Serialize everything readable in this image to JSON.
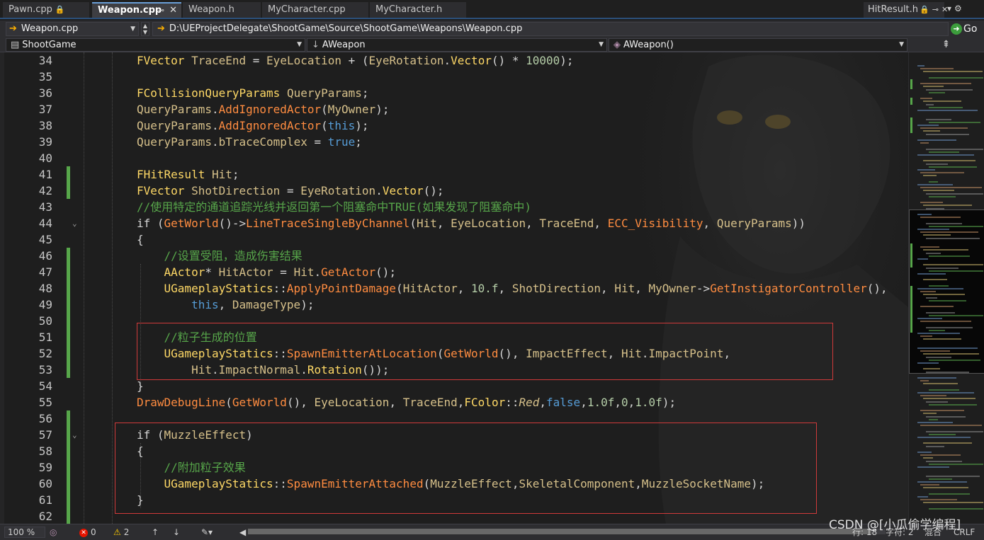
{
  "tabs": [
    {
      "label": "Pawn.cpp",
      "lock": "🔒",
      "active": false
    },
    {
      "label": "Weapon.cpp",
      "active": true
    },
    {
      "label": "Weapon.h",
      "active": false
    },
    {
      "label": "MyCharacter.cpp",
      "active": false
    },
    {
      "label": "MyCharacter.h",
      "active": false
    }
  ],
  "right_tab": {
    "label": "HitResult.h",
    "lock": "🔒"
  },
  "file_selector": {
    "value": "Weapon.cpp"
  },
  "path": {
    "value": "D:\\UEProjectDelegate\\ShootGame\\Source\\ShootGame\\Weapons\\Weapon.cpp"
  },
  "go_button": {
    "label": "Go"
  },
  "nav": {
    "project": "ShootGame",
    "scope": "AWeapon",
    "member": "AWeapon()"
  },
  "code_lines": [
    {
      "n": "34",
      "chg": false,
      "fold": "",
      "tokens": [
        [
          "t-type",
          "FVector"
        ],
        [
          "t-plain",
          " "
        ],
        [
          "t-var",
          "TraceEnd"
        ],
        [
          "t-plain",
          " = "
        ],
        [
          "t-var",
          "EyeLocation"
        ],
        [
          "t-plain",
          " + ("
        ],
        [
          "t-var",
          "EyeRotation"
        ],
        [
          "t-plain",
          "."
        ],
        [
          "t-type",
          "Vector"
        ],
        [
          "t-plain",
          "() * "
        ],
        [
          "t-num",
          "10000"
        ],
        [
          "t-plain",
          ");"
        ]
      ]
    },
    {
      "n": "35",
      "chg": false,
      "fold": "",
      "tokens": []
    },
    {
      "n": "36",
      "chg": false,
      "fold": "",
      "tokens": [
        [
          "t-type",
          "FCollisionQueryParams"
        ],
        [
          "t-plain",
          " "
        ],
        [
          "t-var",
          "QueryParams"
        ],
        [
          "t-plain",
          ";"
        ]
      ]
    },
    {
      "n": "37",
      "chg": false,
      "fold": "",
      "tokens": [
        [
          "t-var",
          "QueryParams"
        ],
        [
          "t-plain",
          "."
        ],
        [
          "t-func",
          "AddIgnoredActor"
        ],
        [
          "t-plain",
          "("
        ],
        [
          "t-var",
          "MyOwner"
        ],
        [
          "t-plain",
          ");"
        ]
      ]
    },
    {
      "n": "38",
      "chg": false,
      "fold": "",
      "tokens": [
        [
          "t-var",
          "QueryParams"
        ],
        [
          "t-plain",
          "."
        ],
        [
          "t-func",
          "AddIgnoredActor"
        ],
        [
          "t-plain",
          "("
        ],
        [
          "t-kw",
          "this"
        ],
        [
          "t-plain",
          ");"
        ]
      ]
    },
    {
      "n": "39",
      "chg": false,
      "fold": "",
      "tokens": [
        [
          "t-var",
          "QueryParams"
        ],
        [
          "t-plain",
          "."
        ],
        [
          "t-var",
          "bTraceComplex"
        ],
        [
          "t-plain",
          " = "
        ],
        [
          "t-kw",
          "true"
        ],
        [
          "t-plain",
          ";"
        ]
      ]
    },
    {
      "n": "40",
      "chg": false,
      "fold": "",
      "tokens": []
    },
    {
      "n": "41",
      "chg": true,
      "fold": "",
      "tokens": [
        [
          "t-type",
          "FHitResult"
        ],
        [
          "t-plain",
          " "
        ],
        [
          "t-var",
          "Hit"
        ],
        [
          "t-plain",
          ";"
        ]
      ]
    },
    {
      "n": "42",
      "chg": true,
      "fold": "",
      "tokens": [
        [
          "t-type",
          "FVector"
        ],
        [
          "t-plain",
          " "
        ],
        [
          "t-var",
          "ShotDirection"
        ],
        [
          "t-plain",
          " = "
        ],
        [
          "t-var",
          "EyeRotation"
        ],
        [
          "t-plain",
          "."
        ],
        [
          "t-type",
          "Vector"
        ],
        [
          "t-plain",
          "();"
        ]
      ]
    },
    {
      "n": "43",
      "chg": false,
      "fold": "",
      "tokens": [
        [
          "t-cmt",
          "//使用特定的通道追踪光线并返回第一个阻塞命中TRUE(如果发现了阻塞命中)"
        ]
      ]
    },
    {
      "n": "44",
      "chg": false,
      "fold": "⌄",
      "tokens": [
        [
          "t-ctl",
          "if"
        ],
        [
          "t-plain",
          " ("
        ],
        [
          "t-func",
          "GetWorld"
        ],
        [
          "t-plain",
          "()->"
        ],
        [
          "t-func",
          "LineTraceSingleByChannel"
        ],
        [
          "t-plain",
          "("
        ],
        [
          "t-var",
          "Hit"
        ],
        [
          "t-plain",
          ", "
        ],
        [
          "t-var",
          "EyeLocation"
        ],
        [
          "t-plain",
          ", "
        ],
        [
          "t-var",
          "TraceEnd"
        ],
        [
          "t-plain",
          ", "
        ],
        [
          "t-func",
          "ECC_Visibility"
        ],
        [
          "t-plain",
          ", "
        ],
        [
          "t-var",
          "QueryParams"
        ],
        [
          "t-plain",
          "))"
        ]
      ]
    },
    {
      "n": "45",
      "chg": false,
      "fold": "",
      "tokens": [
        [
          "t-plain",
          "{"
        ]
      ]
    },
    {
      "n": "46",
      "chg": true,
      "fold": "",
      "tokens": [
        [
          "t-plain",
          "    "
        ],
        [
          "t-cmt",
          "//设置受阻，造成伤害结果"
        ]
      ]
    },
    {
      "n": "47",
      "chg": true,
      "fold": "",
      "tokens": [
        [
          "t-plain",
          "    "
        ],
        [
          "t-type",
          "AActor"
        ],
        [
          "t-plain",
          "* "
        ],
        [
          "t-var",
          "HitActor"
        ],
        [
          "t-plain",
          " = "
        ],
        [
          "t-var",
          "Hit"
        ],
        [
          "t-plain",
          "."
        ],
        [
          "t-func",
          "GetActor"
        ],
        [
          "t-plain",
          "();"
        ]
      ]
    },
    {
      "n": "48",
      "chg": true,
      "fold": "",
      "tokens": [
        [
          "t-plain",
          "    "
        ],
        [
          "t-type",
          "UGameplayStatics"
        ],
        [
          "t-plain",
          "::"
        ],
        [
          "t-func",
          "ApplyPointDamage"
        ],
        [
          "t-plain",
          "("
        ],
        [
          "t-var",
          "HitActor"
        ],
        [
          "t-plain",
          ", "
        ],
        [
          "t-num",
          "10.f"
        ],
        [
          "t-plain",
          ", "
        ],
        [
          "t-var",
          "ShotDirection"
        ],
        [
          "t-plain",
          ", "
        ],
        [
          "t-var",
          "Hit"
        ],
        [
          "t-plain",
          ", "
        ],
        [
          "t-var",
          "MyOwner"
        ],
        [
          "t-plain",
          "->"
        ],
        [
          "t-func",
          "GetInstigatorController"
        ],
        [
          "t-plain",
          "(),"
        ]
      ]
    },
    {
      "n": "49",
      "chg": true,
      "fold": "",
      "tokens": [
        [
          "t-plain",
          "        "
        ],
        [
          "t-kw",
          "this"
        ],
        [
          "t-plain",
          ", "
        ],
        [
          "t-var",
          "DamageType"
        ],
        [
          "t-plain",
          ");"
        ]
      ]
    },
    {
      "n": "50",
      "chg": true,
      "fold": "",
      "tokens": []
    },
    {
      "n": "51",
      "chg": true,
      "fold": "",
      "tokens": [
        [
          "t-plain",
          "    "
        ],
        [
          "t-cmt",
          "//粒子生成的位置"
        ]
      ]
    },
    {
      "n": "52",
      "chg": true,
      "fold": "",
      "tokens": [
        [
          "t-plain",
          "    "
        ],
        [
          "t-type",
          "UGameplayStatics"
        ],
        [
          "t-plain",
          "::"
        ],
        [
          "t-func",
          "SpawnEmitterAtLocation"
        ],
        [
          "t-plain",
          "("
        ],
        [
          "t-func",
          "GetWorld"
        ],
        [
          "t-plain",
          "(), "
        ],
        [
          "t-var",
          "ImpactEffect"
        ],
        [
          "t-plain",
          ", "
        ],
        [
          "t-var",
          "Hit"
        ],
        [
          "t-plain",
          "."
        ],
        [
          "t-var",
          "ImpactPoint"
        ],
        [
          "t-plain",
          ","
        ]
      ]
    },
    {
      "n": "53",
      "chg": true,
      "fold": "",
      "tokens": [
        [
          "t-plain",
          "        "
        ],
        [
          "t-var",
          "Hit"
        ],
        [
          "t-plain",
          "."
        ],
        [
          "t-var",
          "ImpactNormal"
        ],
        [
          "t-plain",
          "."
        ],
        [
          "t-type",
          "Rotation"
        ],
        [
          "t-plain",
          "());"
        ]
      ]
    },
    {
      "n": "54",
      "chg": false,
      "fold": "",
      "tokens": [
        [
          "t-plain",
          "}"
        ]
      ]
    },
    {
      "n": "55",
      "chg": false,
      "fold": "",
      "tokens": [
        [
          "t-func",
          "DrawDebugLine"
        ],
        [
          "t-plain",
          "("
        ],
        [
          "t-func",
          "GetWorld"
        ],
        [
          "t-plain",
          "(), "
        ],
        [
          "t-var",
          "EyeLocation"
        ],
        [
          "t-plain",
          ", "
        ],
        [
          "t-var",
          "TraceEnd"
        ],
        [
          "t-plain",
          ","
        ],
        [
          "t-type",
          "FColor"
        ],
        [
          "t-plain",
          "::"
        ],
        [
          "t-ital",
          "Red"
        ],
        [
          "t-plain",
          ","
        ],
        [
          "t-kw",
          "false"
        ],
        [
          "t-plain",
          ","
        ],
        [
          "t-num",
          "1.0f"
        ],
        [
          "t-plain",
          ","
        ],
        [
          "t-num",
          "0"
        ],
        [
          "t-plain",
          ","
        ],
        [
          "t-num",
          "1.0f"
        ],
        [
          "t-plain",
          ");"
        ]
      ]
    },
    {
      "n": "56",
      "chg": true,
      "fold": "",
      "tokens": []
    },
    {
      "n": "57",
      "chg": true,
      "fold": "⌄",
      "tokens": [
        [
          "t-ctl",
          "if"
        ],
        [
          "t-plain",
          " ("
        ],
        [
          "t-var",
          "MuzzleEffect"
        ],
        [
          "t-plain",
          ")"
        ]
      ]
    },
    {
      "n": "58",
      "chg": true,
      "fold": "",
      "tokens": [
        [
          "t-plain",
          "{"
        ]
      ]
    },
    {
      "n": "59",
      "chg": true,
      "fold": "",
      "tokens": [
        [
          "t-plain",
          "    "
        ],
        [
          "t-cmt",
          "//附加粒子效果"
        ]
      ]
    },
    {
      "n": "60",
      "chg": true,
      "fold": "",
      "tokens": [
        [
          "t-plain",
          "    "
        ],
        [
          "t-type",
          "UGameplayStatics"
        ],
        [
          "t-plain",
          "::"
        ],
        [
          "t-func",
          "SpawnEmitterAttached"
        ],
        [
          "t-plain",
          "("
        ],
        [
          "t-var",
          "MuzzleEffect"
        ],
        [
          "t-plain",
          ","
        ],
        [
          "t-var",
          "SkeletalComponent"
        ],
        [
          "t-plain",
          ","
        ],
        [
          "t-var",
          "MuzzleSocketName"
        ],
        [
          "t-plain",
          ");"
        ]
      ]
    },
    {
      "n": "61",
      "chg": true,
      "fold": "",
      "tokens": [
        [
          "t-plain",
          "}"
        ]
      ]
    },
    {
      "n": "62",
      "chg": true,
      "fold": "",
      "tokens": []
    }
  ],
  "status": {
    "zoom": "100 %",
    "errors": "0",
    "warnings": "2",
    "line": "行: 18",
    "char": "字符: 2",
    "mode": "混合",
    "eol": "CRLF"
  },
  "watermark": "CSDN @[小瓜偷学编程]",
  "colors": {
    "accent": "#2b4f7a",
    "change_bar": "#57a64a",
    "annotation_box": "#d03a3a"
  }
}
